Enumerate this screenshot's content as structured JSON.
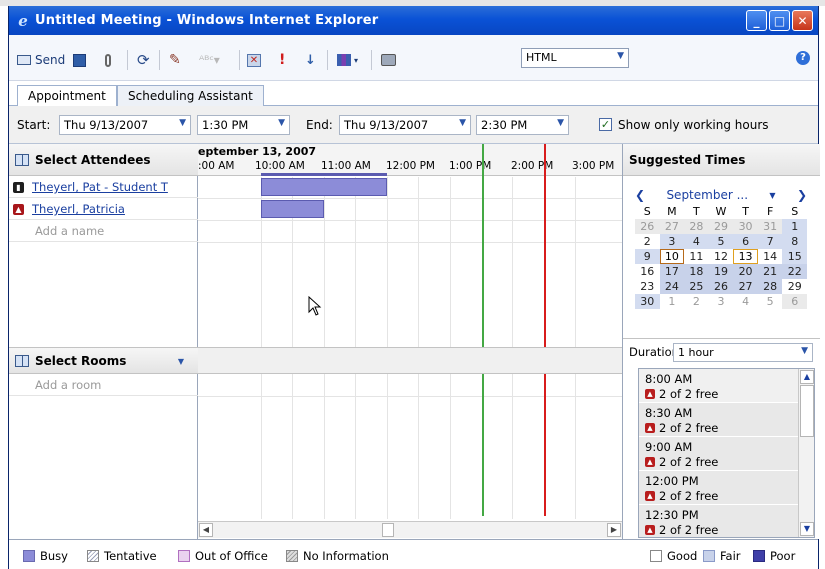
{
  "window": {
    "title": "Untitled Meeting - Windows Internet Explorer",
    "background_strip_text": "…"
  },
  "toolbar": {
    "send_label": "Send",
    "format_value": "HTML"
  },
  "tabs": [
    {
      "label": "Appointment"
    },
    {
      "label": "Scheduling Assistant"
    }
  ],
  "datebar": {
    "start_label": "Start:",
    "start_date": "Thu 9/13/2007",
    "start_time": "1:30 PM",
    "end_label": "End:",
    "end_date": "Thu 9/13/2007",
    "end_time": "2:30 PM",
    "working_hours_label": "Show only working hours",
    "working_hours_checked": true
  },
  "attendees": {
    "header": "Select Attendees",
    "people": [
      {
        "name": "Theyerl, Pat - Student T",
        "icon": "organizer-icon"
      },
      {
        "name": "Theyerl, Patricia",
        "icon": "required-attendee-icon"
      }
    ],
    "add_placeholder": "Add a name"
  },
  "rooms": {
    "header": "Select Rooms",
    "add_placeholder": "Add a room"
  },
  "timeline": {
    "date_label": "eptember 13, 2007",
    "times": [
      ":00 AM",
      "10:00 AM",
      "11:00 AM",
      "12:00 PM",
      "1:00 PM",
      "2:00 PM",
      "3:00 PM"
    ]
  },
  "suggested": {
    "header": "Suggested Times",
    "month_label": "September ...",
    "weekdays": [
      "S",
      "M",
      "T",
      "W",
      "T",
      "F",
      "S"
    ],
    "weeks": [
      [
        "26",
        "27",
        "28",
        "29",
        "30",
        "31",
        "1"
      ],
      [
        "2",
        "3",
        "4",
        "5",
        "6",
        "7",
        "8"
      ],
      [
        "9",
        "10",
        "11",
        "12",
        "13",
        "14",
        "15"
      ],
      [
        "16",
        "17",
        "18",
        "19",
        "20",
        "21",
        "22"
      ],
      [
        "23",
        "24",
        "25",
        "26",
        "27",
        "28",
        "29"
      ],
      [
        "30",
        "1",
        "2",
        "3",
        "4",
        "5",
        "6"
      ]
    ],
    "duration_label": "Duration:",
    "duration_value": "1 hour",
    "slots": [
      {
        "time": "8:00 AM",
        "free": "2 of 2 free"
      },
      {
        "time": "8:30 AM",
        "free": "2 of 2 free"
      },
      {
        "time": "9:00 AM",
        "free": "2 of 2 free"
      },
      {
        "time": "12:00 PM",
        "free": "2 of 2 free"
      },
      {
        "time": "12:30 PM",
        "free": "2 of 2 free"
      }
    ]
  },
  "legend": {
    "busy": "Busy",
    "tentative": "Tentative",
    "out_of_office": "Out of Office",
    "no_information": "No Information",
    "good": "Good",
    "fair": "Fair",
    "poor": "Poor"
  },
  "colors": {
    "busy": "#8c8cd8",
    "start_line": "#44a844",
    "end_line": "#d81c1c",
    "titlebar": "#0a52d6"
  }
}
